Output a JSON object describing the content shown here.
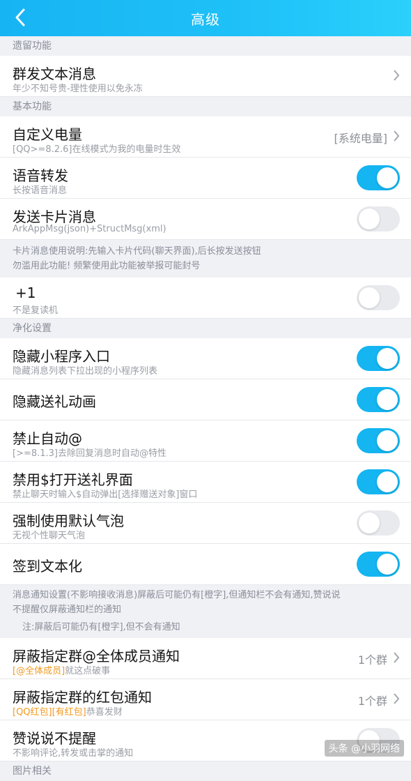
{
  "header": {
    "title": "高级"
  },
  "sections": {
    "legacy": "遗留功能",
    "basic": "基本功能",
    "clean": "净化设置",
    "image": "图片相关"
  },
  "rows": {
    "mass_text": {
      "label": "群发文本消息",
      "sub": "年少不知号贵-理性使用以免永冻"
    },
    "custom_battery": {
      "label": "自定义电量",
      "sub": "[QQ>=8.2.6]在线模式为我的电量时生效",
      "value": "[系统电量]"
    },
    "voice_forward": {
      "label": "语音转发",
      "sub": "长按语音消息",
      "on": true
    },
    "send_card": {
      "label": "发送卡片消息",
      "sub": "ArkAppMsg(json)+StructMsg(xml)",
      "on": false
    },
    "plus_one": {
      "label": "+1",
      "sub": "不是复读机",
      "on": false
    },
    "hide_mini": {
      "label": "隐藏小程序入口",
      "sub": "隐藏消息列表下拉出现的小程序列表",
      "on": true
    },
    "hide_gift": {
      "label": "隐藏送礼动画",
      "on": true
    },
    "no_auto_at": {
      "label": "禁止自动@",
      "sub": "[>=8.1.3]去除回复消息时自动@特性",
      "on": true
    },
    "no_gift_ui": {
      "label": "禁用$打开送礼界面",
      "sub": "禁止聊天时输入$自动弹出[选择赠送对象]窗口",
      "on": true
    },
    "default_bubble": {
      "label": "强制使用默认气泡",
      "sub": "无视个性聊天气泡",
      "on": false
    },
    "checkin_text": {
      "label": "签到文本化",
      "on": true
    },
    "block_at_all": {
      "label": "屏蔽指定群@全体成员通知",
      "sub_orange": "[@全体成员]",
      "sub_rest": "就这点破事",
      "value": "1个群"
    },
    "block_redpack": {
      "label": "屏蔽指定群的红包通知",
      "sub_orange": "[QQ红包][有红包]",
      "sub_rest": "恭喜发财",
      "value": "1个群"
    },
    "like_no_notify": {
      "label": "赞说说不提醒",
      "sub": "不影响评论,转发或击掌的通知",
      "on": false
    }
  },
  "notes": {
    "card_usage_1": "卡片消息使用说明:先输入卡片代码(聊天界面),后长按发送按钮",
    "card_usage_2": "勿滥用此功能! 频繁使用此功能被举报可能封号",
    "notify_1": "消息通知设置(不影响接收消息)屏蔽后可能仍有[橙字],但通知栏不会有通知,赞说说",
    "notify_2": "不提醒仅屏蔽通知栏的通知",
    "notify_3": "注:屏蔽后可能仍有[橙字],但不会有通知"
  },
  "watermark": "头条 @小羽网络",
  "colors": {
    "accent": "#14b5f1",
    "orange": "#f39a22"
  }
}
